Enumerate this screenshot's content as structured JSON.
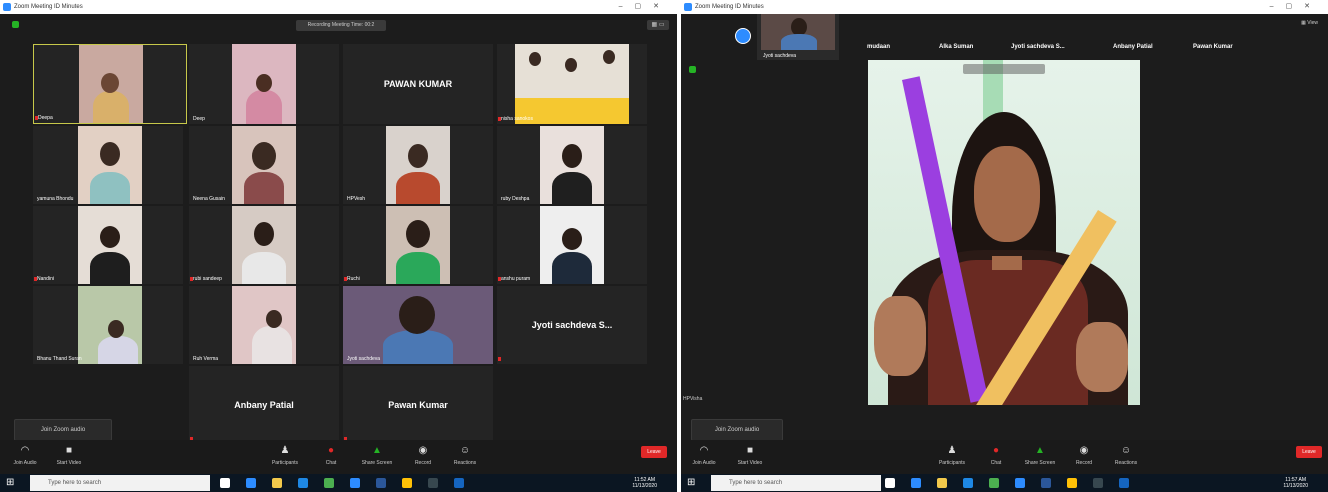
{
  "left": {
    "window_title": "Zoom Meeting ID Minutes",
    "recording_badge": "Recording Meeting Time: 00:2",
    "tiles": [
      {
        "name": "Deepa"
      },
      {
        "name": "Deep"
      },
      {
        "name": "PAWAN KUMAR",
        "big": true
      },
      {
        "name": "nisha sanokos"
      },
      {
        "name": "yamuna Bhondu"
      },
      {
        "name": "Neena Gusain"
      },
      {
        "name": "HPVesh"
      },
      {
        "name": "ruby Deshpa"
      },
      {
        "name": "Nandini"
      },
      {
        "name": "rubi sandeep"
      },
      {
        "name": "Ruchi"
      },
      {
        "name": "anshu puram"
      },
      {
        "name": "Bhanu Thand Suran"
      },
      {
        "name": "Ruh Verma"
      },
      {
        "name": "Jyoti sachdeva"
      },
      {
        "name": "Jyoti sachdeva S...",
        "big": true
      },
      {
        "name": "Anbany Patial",
        "big": true
      },
      {
        "name": "Pawan Kumar",
        "big": true
      }
    ],
    "join_audio": "Join Zoom audio",
    "controls": [
      "Join Audio",
      "Start Video",
      "Participants",
      "Chat",
      "Share Screen",
      "Record",
      "Reactions"
    ],
    "end": "Leave",
    "search_placeholder": "Type here to search",
    "clock_time": "11:52 AM",
    "clock_date": "11/13/2020"
  },
  "right": {
    "window_title": "Zoom Meeting ID Minutes",
    "strip_names": [
      "mudaan",
      "Alka Suman",
      "Jyoti sachdeva S...",
      "Anbany Patial",
      "Pawan Kumar"
    ],
    "thumb_name": "Jyoti sachdeva",
    "view_label": "View",
    "speaker_caption": "",
    "side_name": "HPVisha",
    "join_audio": "Join Zoom audio",
    "controls": [
      "Join Audio",
      "Start Video",
      "Participants",
      "Chat",
      "Share Screen",
      "Record",
      "Reactions"
    ],
    "end": "Leave",
    "search_placeholder": "Type here to search",
    "clock_time": "11:57 AM",
    "clock_date": "11/13/2020"
  },
  "colors": {
    "window_bg": "#1c1c1c",
    "tile_bg": "#242424",
    "active_speaker": "#c7c84a",
    "end_red": "#e02828",
    "taskbar": "#0b1622",
    "accent_blue": "#2d8cff"
  }
}
